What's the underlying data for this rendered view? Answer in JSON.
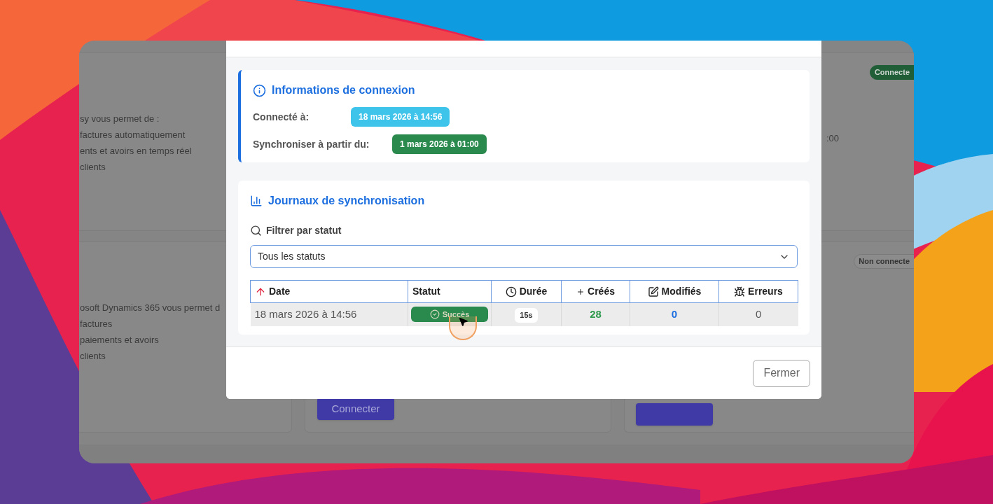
{
  "background_page": {
    "left_cards": [
      {
        "lines": [
          "sy vous permet de :",
          "factures automatiquement",
          "ents et avoirs en temps réel",
          "clients"
        ]
      },
      {
        "lines": [
          "osoft Dynamics 365 vous permet d",
          "factures",
          "paiements et avoirs",
          "clients"
        ]
      }
    ],
    "middle_button": "Connecter",
    "right_cards": [
      {
        "status": "Connecte",
        "kind": "connected",
        "line": ":00"
      },
      {
        "status": "Non connecte",
        "kind": "disconnected"
      }
    ]
  },
  "modal": {
    "info": {
      "title": "Informations de connexion",
      "rows": [
        {
          "label": "Connecté à:",
          "value": "18 mars 2026 à 14:56",
          "color": "#3ec3ea"
        },
        {
          "label": "Synchroniser à partir du:",
          "value": "1 mars 2026 à 01:00",
          "color": "#2a8a4e"
        }
      ]
    },
    "logs": {
      "title": "Journaux de synchronisation",
      "filter_label": "Filtrer par statut",
      "select_value": "Tous les statuts",
      "columns": [
        "Date",
        "Statut",
        "Durée",
        "Créés",
        "Modifiés",
        "Erreurs"
      ],
      "rows": [
        {
          "date": "18 mars 2026 à 14:56",
          "status": "Succès",
          "kind": "success",
          "duration": "15s",
          "created": "28",
          "modified": "0",
          "errors": "0"
        }
      ]
    },
    "close_button": "Fermer"
  }
}
